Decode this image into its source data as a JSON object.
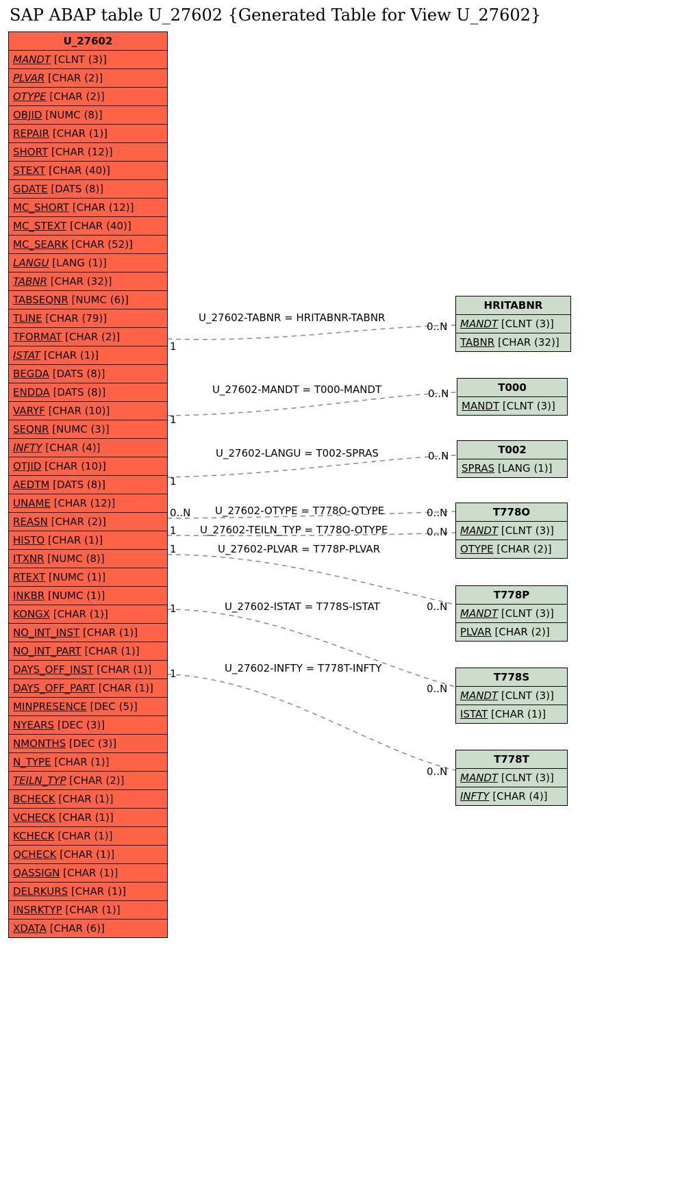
{
  "title": "SAP ABAP table U_27602 {Generated Table for View U_27602}",
  "main_entity": {
    "name": "U_27602",
    "fields": [
      {
        "name": "MANDT",
        "type": "[CLNT (3)]",
        "italic": true
      },
      {
        "name": "PLVAR",
        "type": "[CHAR (2)]",
        "italic": true
      },
      {
        "name": "OTYPE",
        "type": "[CHAR (2)]",
        "italic": true
      },
      {
        "name": "OBJID",
        "type": "[NUMC (8)]",
        "italic": false
      },
      {
        "name": "REPAIR",
        "type": "[CHAR (1)]",
        "italic": false
      },
      {
        "name": "SHORT",
        "type": "[CHAR (12)]",
        "italic": false
      },
      {
        "name": "STEXT",
        "type": "[CHAR (40)]",
        "italic": false
      },
      {
        "name": "GDATE",
        "type": "[DATS (8)]",
        "italic": false
      },
      {
        "name": "MC_SHORT",
        "type": "[CHAR (12)]",
        "italic": false
      },
      {
        "name": "MC_STEXT",
        "type": "[CHAR (40)]",
        "italic": false
      },
      {
        "name": "MC_SEARK",
        "type": "[CHAR (52)]",
        "italic": false
      },
      {
        "name": "LANGU",
        "type": "[LANG (1)]",
        "italic": true
      },
      {
        "name": "TABNR",
        "type": "[CHAR (32)]",
        "italic": true
      },
      {
        "name": "TABSEQNR",
        "type": "[NUMC (6)]",
        "italic": false
      },
      {
        "name": "TLINE",
        "type": "[CHAR (79)]",
        "italic": false
      },
      {
        "name": "TFORMAT",
        "type": "[CHAR (2)]",
        "italic": false
      },
      {
        "name": "ISTAT",
        "type": "[CHAR (1)]",
        "italic": true
      },
      {
        "name": "BEGDA",
        "type": "[DATS (8)]",
        "italic": false
      },
      {
        "name": "ENDDA",
        "type": "[DATS (8)]",
        "italic": false
      },
      {
        "name": "VARYF",
        "type": "[CHAR (10)]",
        "italic": false
      },
      {
        "name": "SEQNR",
        "type": "[NUMC (3)]",
        "italic": false
      },
      {
        "name": "INFTY",
        "type": "[CHAR (4)]",
        "italic": true
      },
      {
        "name": "OTJID",
        "type": "[CHAR (10)]",
        "italic": false
      },
      {
        "name": "AEDTM",
        "type": "[DATS (8)]",
        "italic": false
      },
      {
        "name": "UNAME",
        "type": "[CHAR (12)]",
        "italic": false
      },
      {
        "name": "REASN",
        "type": "[CHAR (2)]",
        "italic": false
      },
      {
        "name": "HISTO",
        "type": "[CHAR (1)]",
        "italic": false
      },
      {
        "name": "ITXNR",
        "type": "[NUMC (8)]",
        "italic": false
      },
      {
        "name": "RTEXT",
        "type": "[NUMC (1)]",
        "italic": false
      },
      {
        "name": "INKBR",
        "type": "[NUMC (1)]",
        "italic": false
      },
      {
        "name": "KONGX",
        "type": "[CHAR (1)]",
        "italic": false
      },
      {
        "name": "NO_INT_INST",
        "type": "[CHAR (1)]",
        "italic": false
      },
      {
        "name": "NO_INT_PART",
        "type": "[CHAR (1)]",
        "italic": false
      },
      {
        "name": "DAYS_OFF_INST",
        "type": "[CHAR (1)]",
        "italic": false
      },
      {
        "name": "DAYS_OFF_PART",
        "type": "[CHAR (1)]",
        "italic": false
      },
      {
        "name": "MINPRESENCE",
        "type": "[DEC (5)]",
        "italic": false
      },
      {
        "name": "NYEARS",
        "type": "[DEC (3)]",
        "italic": false
      },
      {
        "name": "NMONTHS",
        "type": "[DEC (3)]",
        "italic": false
      },
      {
        "name": "N_TYPE",
        "type": "[CHAR (1)]",
        "italic": false
      },
      {
        "name": "TEILN_TYP",
        "type": "[CHAR (2)]",
        "italic": true
      },
      {
        "name": "BCHECK",
        "type": "[CHAR (1)]",
        "italic": false
      },
      {
        "name": "VCHECK",
        "type": "[CHAR (1)]",
        "italic": false
      },
      {
        "name": "KCHECK",
        "type": "[CHAR (1)]",
        "italic": false
      },
      {
        "name": "QCHECK",
        "type": "[CHAR (1)]",
        "italic": false
      },
      {
        "name": "QASSIGN",
        "type": "[CHAR (1)]",
        "italic": false
      },
      {
        "name": "DELRKURS",
        "type": "[CHAR (1)]",
        "italic": false
      },
      {
        "name": "INSRKTYP",
        "type": "[CHAR (1)]",
        "italic": false
      },
      {
        "name": "XDATA",
        "type": "[CHAR (6)]",
        "italic": false
      }
    ]
  },
  "related_entities": [
    {
      "name": "HRITABNR",
      "fields": [
        {
          "name": "MANDT",
          "type": "[CLNT (3)]",
          "italic": true
        },
        {
          "name": "TABNR",
          "type": "[CHAR (32)]",
          "italic": false
        }
      ]
    },
    {
      "name": "T000",
      "fields": [
        {
          "name": "MANDT",
          "type": "[CLNT (3)]",
          "italic": false
        }
      ]
    },
    {
      "name": "T002",
      "fields": [
        {
          "name": "SPRAS",
          "type": "[LANG (1)]",
          "italic": false
        }
      ]
    },
    {
      "name": "T778O",
      "fields": [
        {
          "name": "MANDT",
          "type": "[CLNT (3)]",
          "italic": true
        },
        {
          "name": "OTYPE",
          "type": "[CHAR (2)]",
          "italic": false
        }
      ]
    },
    {
      "name": "T778P",
      "fields": [
        {
          "name": "MANDT",
          "type": "[CLNT (3)]",
          "italic": true
        },
        {
          "name": "PLVAR",
          "type": "[CHAR (2)]",
          "italic": false
        }
      ]
    },
    {
      "name": "T778S",
      "fields": [
        {
          "name": "MANDT",
          "type": "[CLNT (3)]",
          "italic": true
        },
        {
          "name": "ISTAT",
          "type": "[CHAR (1)]",
          "italic": false
        }
      ]
    },
    {
      "name": "T778T",
      "fields": [
        {
          "name": "MANDT",
          "type": "[CLNT (3)]",
          "italic": true
        },
        {
          "name": "INFTY",
          "type": "[CHAR (4)]",
          "italic": true
        }
      ]
    }
  ],
  "relations": [
    {
      "label": "U_27602-TABNR = HRITABNR-TABNR",
      "left_card": "1",
      "right_card": "0..N"
    },
    {
      "label": "U_27602-MANDT = T000-MANDT",
      "left_card": "1",
      "right_card": "0..N"
    },
    {
      "label": "U_27602-LANGU = T002-SPRAS",
      "left_card": "1",
      "right_card": "0..N"
    },
    {
      "label": "U_27602-OTYPE = T778O-OTYPE",
      "left_card": "0..N",
      "right_card": "0..N"
    },
    {
      "label": "U_27602-TEILN_TYP = T778O-OTYPE",
      "left_card": "1",
      "right_card": "0..N"
    },
    {
      "label": "U_27602-PLVAR = T778P-PLVAR",
      "left_card": "1",
      "right_card": ""
    },
    {
      "label": "U_27602-ISTAT = T778S-ISTAT",
      "left_card": "1",
      "right_card": "0..N"
    },
    {
      "label": "U_27602-INFTY = T778T-INFTY",
      "left_card": "1",
      "right_card": "0..N"
    }
  ]
}
